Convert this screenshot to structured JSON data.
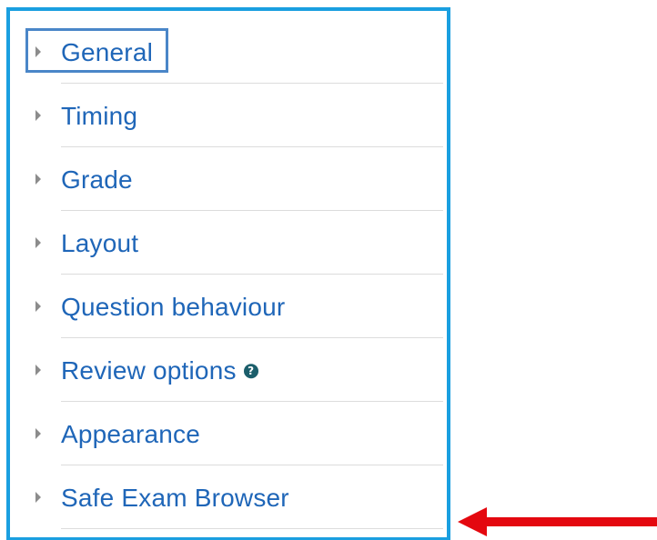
{
  "sections": [
    {
      "label": "General"
    },
    {
      "label": "Timing"
    },
    {
      "label": "Grade"
    },
    {
      "label": "Layout"
    },
    {
      "label": "Question behaviour"
    },
    {
      "label": "Review options",
      "help_icon": "question-circle-icon"
    },
    {
      "label": "Appearance"
    },
    {
      "label": "Safe Exam Browser"
    }
  ],
  "colors": {
    "panel_border": "#1a9fe0",
    "link": "#1f66b8",
    "focus_outline": "#4a86c8",
    "arrow": "#e4080f"
  },
  "annotation": {
    "arrow_icon": "left-arrow-icon"
  }
}
